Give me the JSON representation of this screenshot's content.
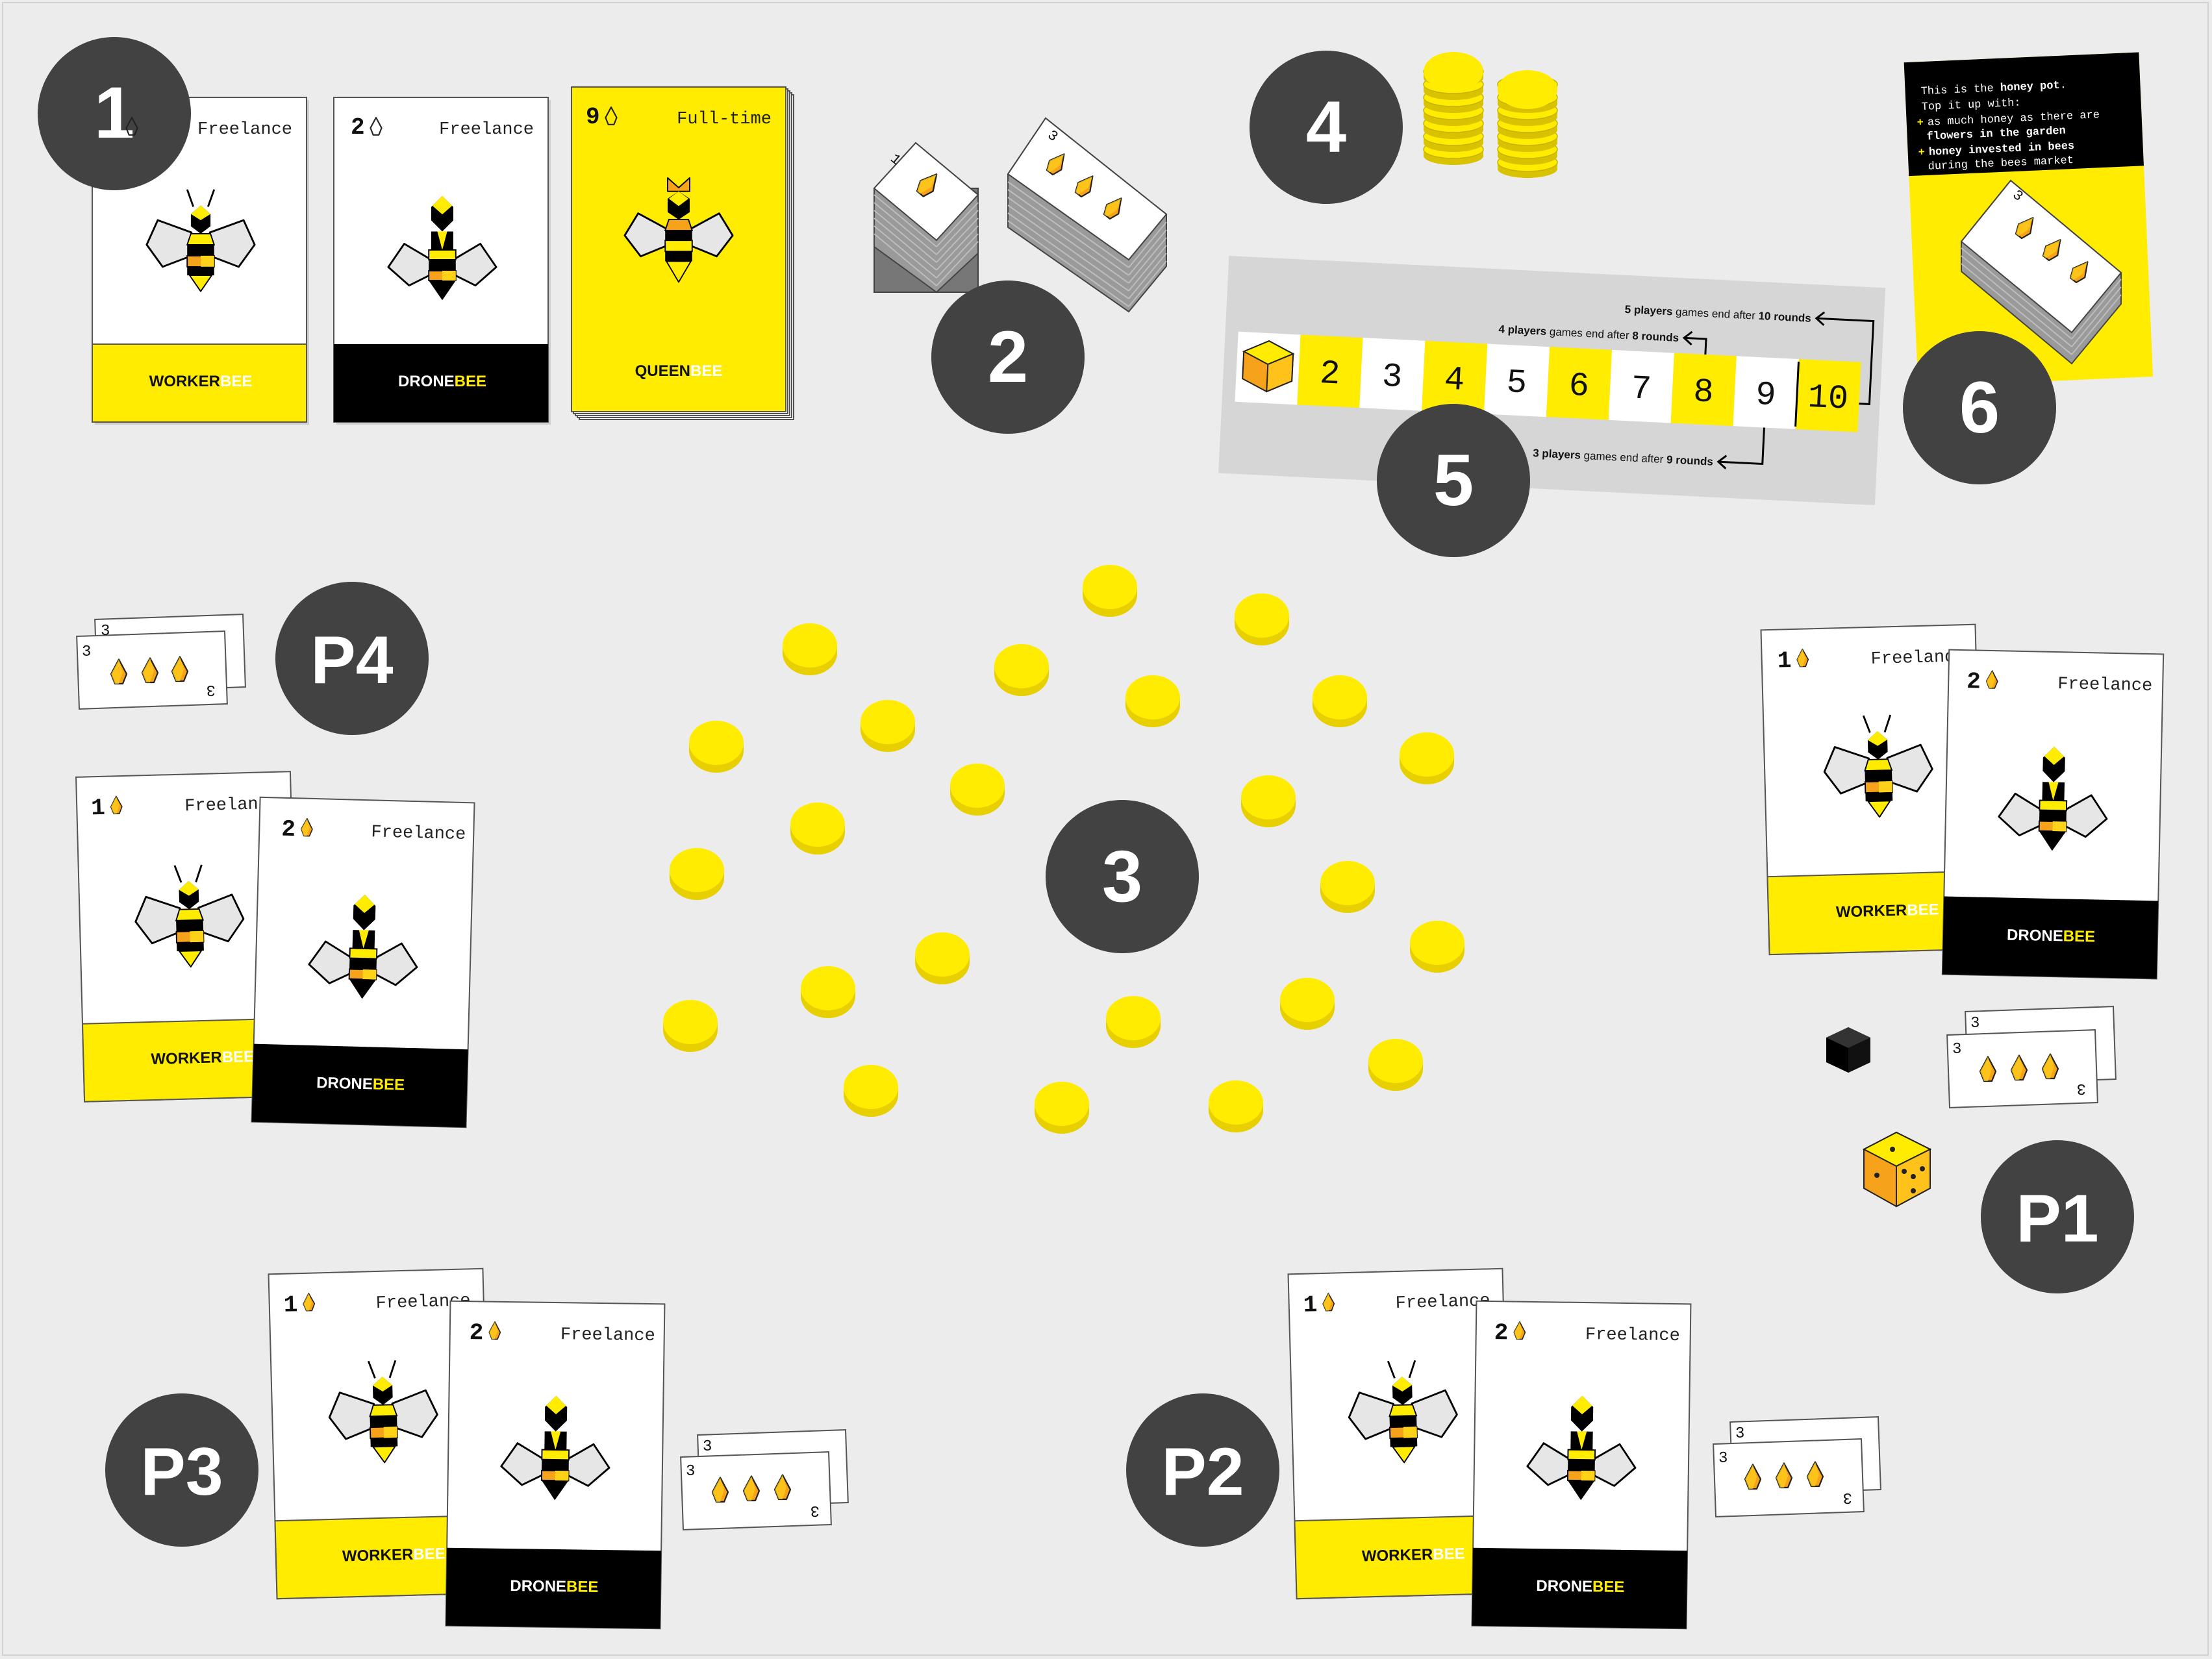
{
  "labels": {
    "supply_cards": "1",
    "honey_cards": "2",
    "tokens": "3",
    "coins": "4",
    "track": "5",
    "pot": "6",
    "p1": "P1",
    "p2": "P2",
    "p3": "P3",
    "p4": "P4"
  },
  "cards": {
    "worker": {
      "cost": "1",
      "type": "Freelance",
      "name_a": "WORKER",
      "name_b": "BEE"
    },
    "drone": {
      "cost": "2",
      "type": "Freelance",
      "name_a": "DRONE",
      "name_b": "BEE"
    },
    "queen": {
      "cost": "9",
      "type": "Full-time",
      "name_a": "QUEEN",
      "name_b": "BEE"
    }
  },
  "honey_cards": {
    "one": "1",
    "three": "3"
  },
  "track": {
    "cells": [
      "2",
      "3",
      "4",
      "5",
      "6",
      "7",
      "8",
      "9",
      "10"
    ],
    "note5_bold": "5 players",
    "note5_a": " games end after ",
    "note5_b": "10 rounds",
    "note4_bold": "4 players",
    "note4_a": " games end after ",
    "note4_b": "8 rounds",
    "note3_bold": "3 players",
    "note3_a": " games end after ",
    "note3_b": "9 rounds"
  },
  "pot": {
    "l1a": "This is the ",
    "l1b": "honey pot",
    "l1c": ".",
    "l2": "Top it up with:",
    "plus": "+",
    "l3": "as much honey as there are",
    "l4": "flowers in the garden",
    "l5": "honey invested in bees",
    "l6": "during the bees market"
  },
  "colors": {
    "yellow": "#ffec00",
    "dark": "#424242",
    "black": "#000000",
    "orange": "#f7a21b",
    "table": "#ececec"
  }
}
